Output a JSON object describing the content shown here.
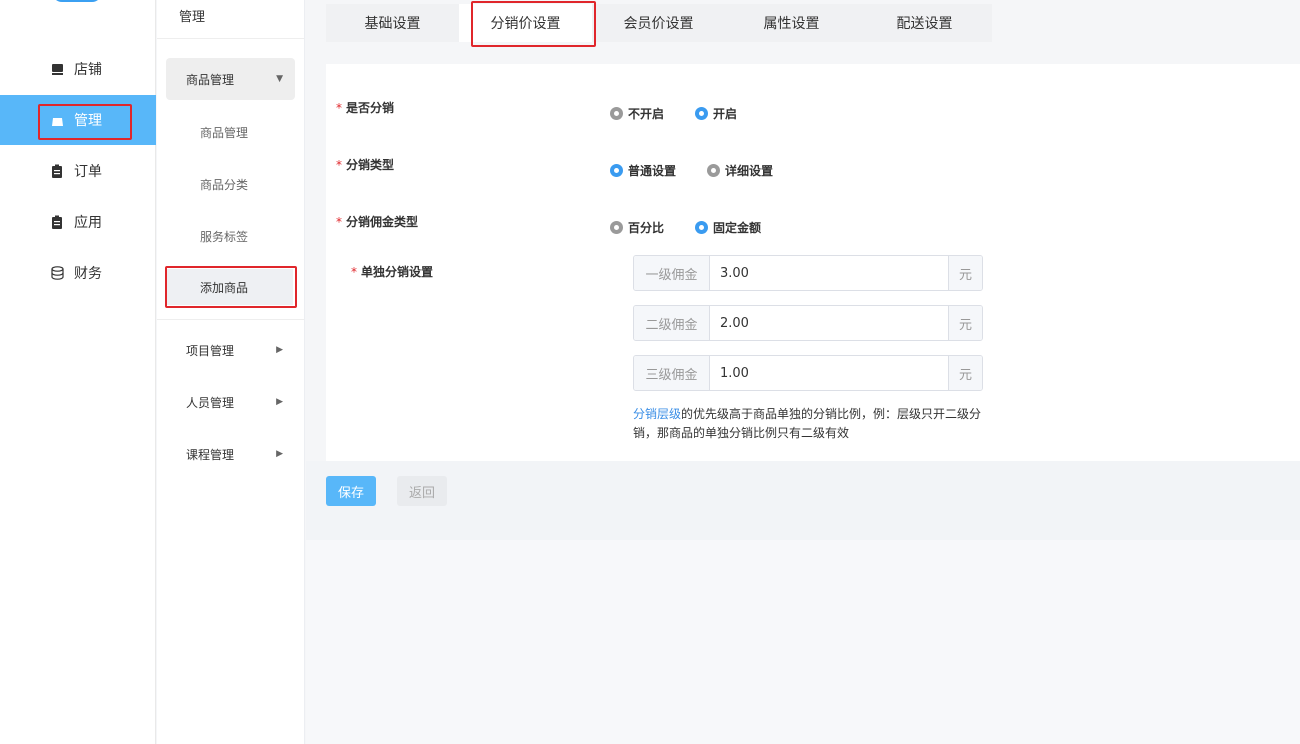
{
  "nav": {
    "items": [
      {
        "label": "店铺",
        "icon": "store-icon"
      },
      {
        "label": "管理",
        "icon": "bag-icon",
        "active": true
      },
      {
        "label": "订单",
        "icon": "clipboard-icon"
      },
      {
        "label": "应用",
        "icon": "clipboard-icon"
      },
      {
        "label": "财务",
        "icon": "database-icon"
      }
    ]
  },
  "subnav": {
    "title": "管理",
    "group_product": "商品管理",
    "items": [
      "商品管理",
      "商品分类",
      "服务标签",
      "添加商品"
    ],
    "groups": [
      "项目管理",
      "人员管理",
      "课程管理"
    ]
  },
  "tabs": [
    "基础设置",
    "分销价设置",
    "会员价设置",
    "属性设置",
    "配送设置"
  ],
  "form": {
    "is_distribution": {
      "label": "是否分销",
      "options": [
        "不开启",
        "开启"
      ],
      "selected": "开启"
    },
    "distribution_type": {
      "label": "分销类型",
      "options": [
        "普通设置",
        "详细设置"
      ],
      "selected": "普通设置"
    },
    "commission_type": {
      "label": "分销佣金类型",
      "options": [
        "百分比",
        "固定金额"
      ],
      "selected": "固定金额"
    },
    "individual": {
      "label": "单独分销设置",
      "rows": [
        {
          "prefix": "一级佣金",
          "value": "3.00",
          "suffix": "元"
        },
        {
          "prefix": "二级佣金",
          "value": "2.00",
          "suffix": "元"
        },
        {
          "prefix": "三级佣金",
          "value": "1.00",
          "suffix": "元"
        }
      ]
    },
    "hint_link": "分销层级",
    "hint_text": "的优先级高于商品单独的分销比例，例：层级只开二级分销，那商品的单独分销比例只有二级有效"
  },
  "buttons": {
    "save": "保存",
    "back": "返回"
  },
  "colors": {
    "accent": "#58b7f9",
    "radio_on": "#3a9bf0",
    "highlight": "#e0262b"
  }
}
